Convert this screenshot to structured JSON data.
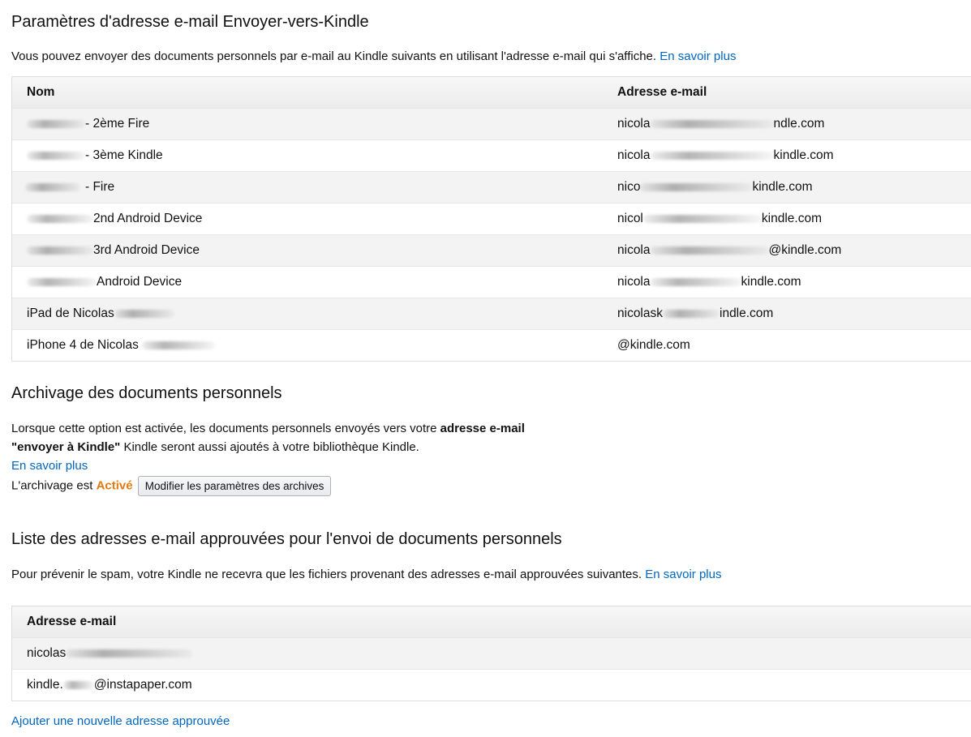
{
  "section1": {
    "title": "Paramètres d'adresse e-mail Envoyer-vers-Kindle",
    "description": "Vous pouvez envoyer des documents personnels par e-mail au Kindle suivants en utilisant l'adresse e-mail qui s'affiche.",
    "learn_more": "En savoir plus",
    "col_name": "Nom",
    "col_email": "Adresse e-mail",
    "devices": [
      {
        "name": "- 2ème Fire",
        "email_prefix": "nicola",
        "email_suffix": "ndle.com"
      },
      {
        "name": "- 3ème Kindle",
        "email_prefix": "nicola",
        "email_suffix": "kindle.com"
      },
      {
        "name": "- Fire",
        "email_prefix": "nico",
        "email_suffix": "kindle.com"
      },
      {
        "name": "2nd Android Device",
        "email_prefix": "nicol",
        "email_suffix": "kindle.com"
      },
      {
        "name": "3rd Android Device",
        "email_prefix": "nicola",
        "email_suffix": "@kindle.com"
      },
      {
        "name": "Android Device",
        "email_prefix": "nicola",
        "email_suffix": "kindle.com"
      },
      {
        "name": "iPad de Nicolas",
        "email_prefix": "nicolask",
        "email_suffix": "indle.com"
      },
      {
        "name": "iPhone 4 de Nicolas",
        "email_prefix": "",
        "email_suffix": "@kindle.com"
      }
    ]
  },
  "section2": {
    "title": "Archivage des documents personnels",
    "text_before_bold": "Lorsque cette option est activée, les documents personnels envoyés vers votre ",
    "bold_1": "adresse e-mail",
    "bold_2": "\"envoyer à Kindle\"",
    "text_after_bold": " Kindle seront aussi ajoutés à votre bibliothèque Kindle.",
    "learn_more": "En savoir plus",
    "status_label": "L'archivage est ",
    "status_value": "Activé",
    "modify_button": "Modifier les paramètres des archives",
    "status_color": "#e47911"
  },
  "section3": {
    "title": "Liste des adresses e-mail approuvées pour l'envoi de documents personnels",
    "description": "Pour prévenir le spam, votre Kindle ne recevra que les fichiers provenant des adresses e-mail approuvées suivantes.",
    "learn_more": "En savoir plus",
    "col_email": "Adresse e-mail",
    "emails": [
      {
        "prefix": "nicolas",
        "suffix": ""
      },
      {
        "prefix": "kindle.",
        "suffix": "@instapaper.com"
      }
    ],
    "add_link": "Ajouter une nouvelle adresse approuvée"
  },
  "colors": {
    "link": "#0066c0",
    "accent": "#e47911"
  }
}
